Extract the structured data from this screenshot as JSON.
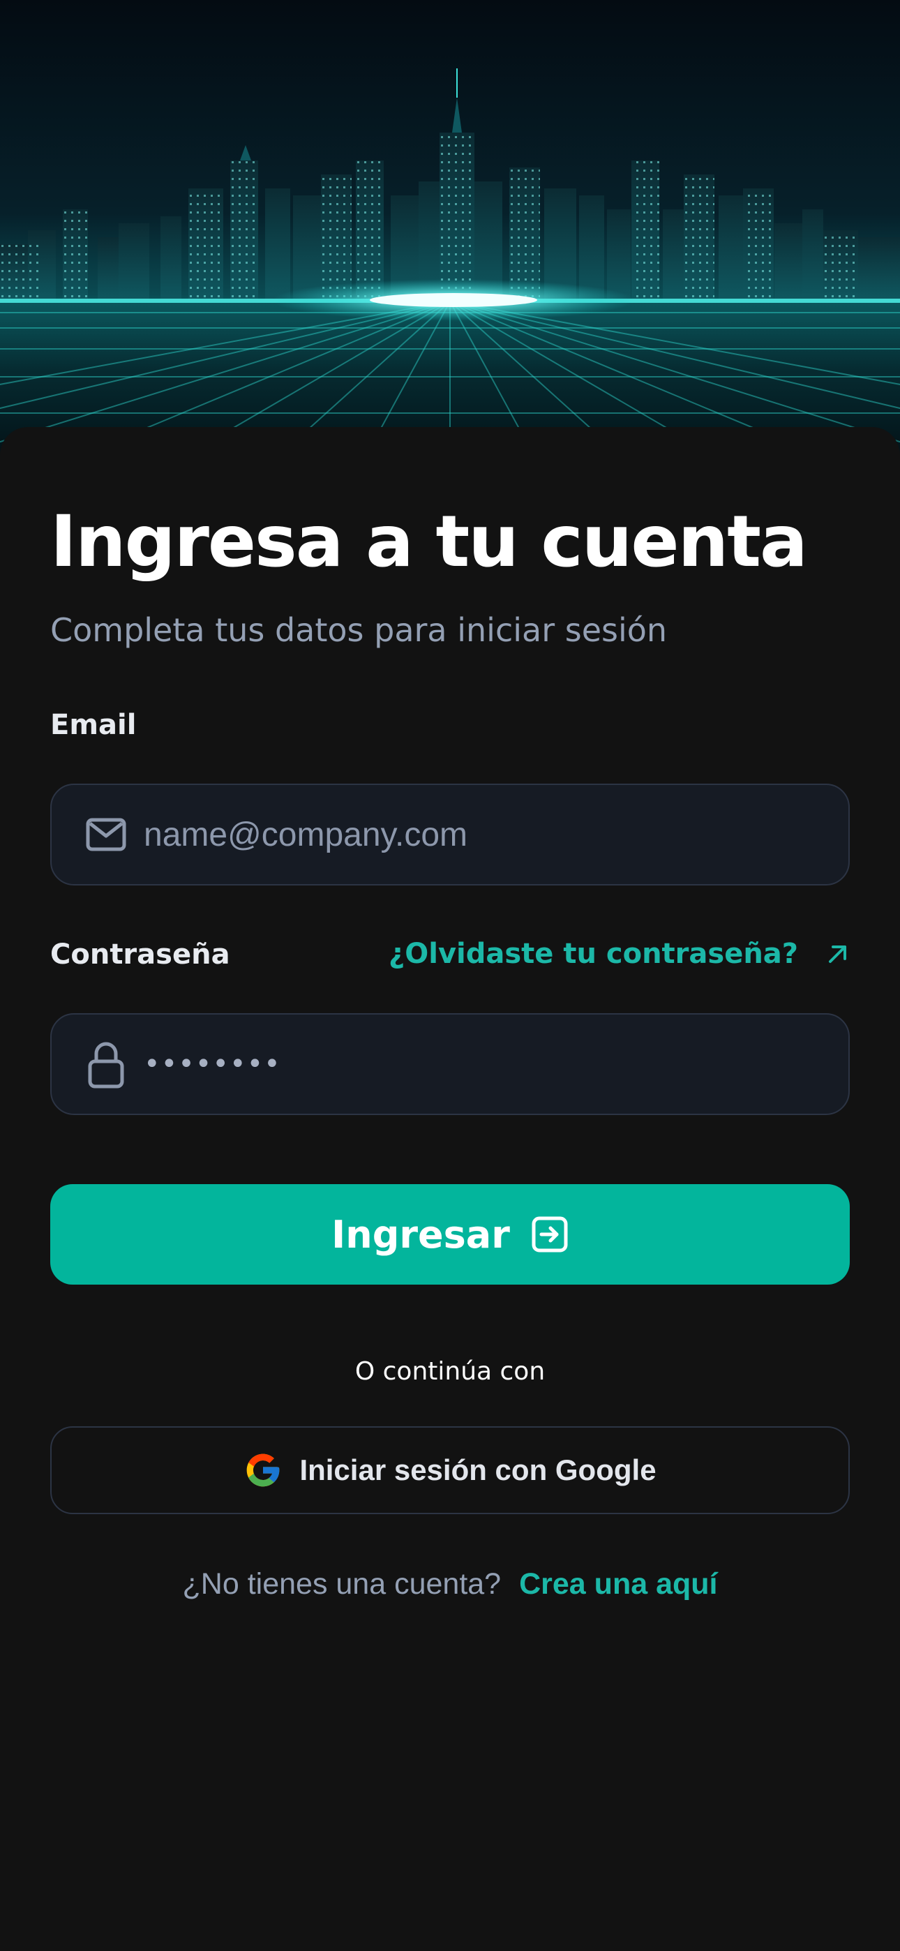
{
  "login": {
    "title": "Ingresa a tu cuenta",
    "subtitle": "Completa tus datos para iniciar sesión",
    "email_label": "Email",
    "email_placeholder": "name@company.com",
    "password_label": "Contraseña",
    "password_value": "••••••••",
    "forgot_password": "¿Olvidaste tu contraseña?",
    "submit_label": "Ingresar",
    "divider": "O continúa con",
    "google_label": "Iniciar sesión con Google",
    "no_account": "¿No tienes una cuenta?",
    "signup_link": "Crea una aquí"
  },
  "icons": {
    "email": "mail-icon",
    "password": "lock-icon",
    "forgot": "arrow-up-right-icon",
    "submit": "login-arrow-icon",
    "google": "google-logo-icon"
  },
  "colors": {
    "accent": "#03b59c",
    "link": "#1cb8a8",
    "background": "#111111",
    "field_background": "#161b24",
    "field_border": "#2c3444",
    "muted_text": "#94a0b4"
  }
}
